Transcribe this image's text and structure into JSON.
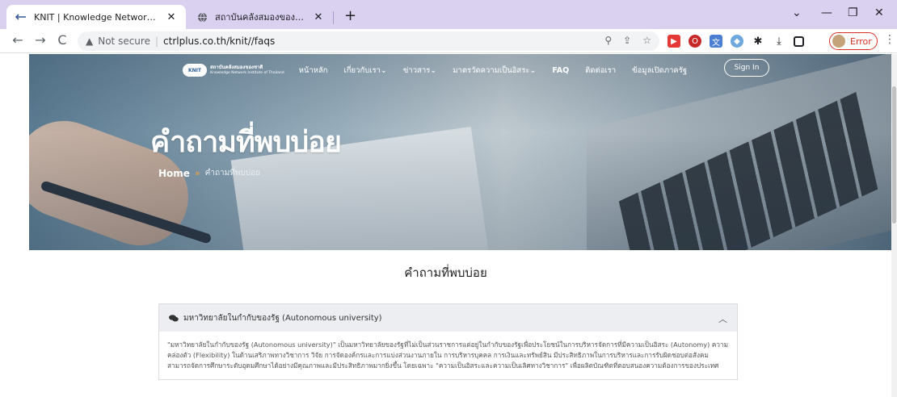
{
  "browser": {
    "tabs": [
      {
        "title": "KNIT | Knowledge Network Instit",
        "active": true
      },
      {
        "title": "สถาบันคลังสมองของชาติ PHP CI MA",
        "active": false
      }
    ],
    "new_tab_label": "+",
    "url": {
      "security_label": "Not secure",
      "address": "ctrlplus.co.th/knit//faqs"
    },
    "profile_status": "Error"
  },
  "site": {
    "logo": {
      "mark": "KNIT",
      "name_line1": "สถาบันคลังสมองของชาติ",
      "name_line2": "Knowledge Network Institute of Thailand"
    },
    "nav": [
      {
        "label": "หน้าหลัก",
        "has_dropdown": false
      },
      {
        "label": "เกี่ยวกับเรา",
        "has_dropdown": true
      },
      {
        "label": "ข่าวสาร",
        "has_dropdown": true
      },
      {
        "label": "มาตรวัดความเป็นอิสระ",
        "has_dropdown": true
      },
      {
        "label": "FAQ",
        "has_dropdown": false
      },
      {
        "label": "ติดต่อเรา",
        "has_dropdown": false
      },
      {
        "label": "ข้อมูลเปิดภาครัฐ",
        "has_dropdown": false
      }
    ],
    "signin_label": "Sign In",
    "hero": {
      "title": "คำถามที่พบบ่อย",
      "breadcrumb_home": "Home",
      "breadcrumb_sep": "»",
      "breadcrumb_current": "คำถามที่พบบ่อย"
    },
    "section_title": "คำถามที่พบบ่อย",
    "faq": [
      {
        "question": "มหาวิทยาลัยในกำกับของรัฐ (Autonomous university)",
        "expanded": true,
        "answer": "\"มหาวิทยาลัยในกำกับของรัฐ (Autonomous university)\" เป็นมหาวิทยาลัยของรัฐที่ไม่เป็นส่วนราชการแต่อยู่ในกำกับของรัฐเพื่อประโยชน์ในการบริหารจัดการที่มีความเป็นอิสระ (Autonomy) ความคล่องตัว (Flexibility) ในด้านเสริภาพทางวิชาการ วิจัย การจัดองค์กรและการแบ่งส่วนงานภายใน การบริหารบุคคล การเงินและทรัพย์สิน มีประสิทธิภาพในการบริหารและการรับผิดชอบต่อสังคม สามารถจัดการศึกษาระดับอุดมศึกษาได้อย่างมีคุณภาพและมีประสิทธิภาพมากยิ่งขึ้น โดยเฉพาะ \"ความเป็นอิสระและความเป็นเลิศทางวิชาการ\" เพื่อผลิตบัณฑิตที่ตอบสนองความต้องการของประเทศ"
      }
    ]
  },
  "colors": {
    "tabbar_bg": "#dad0f0",
    "accent_breadcrumb": "#f4a33a",
    "error": "#d93025"
  }
}
